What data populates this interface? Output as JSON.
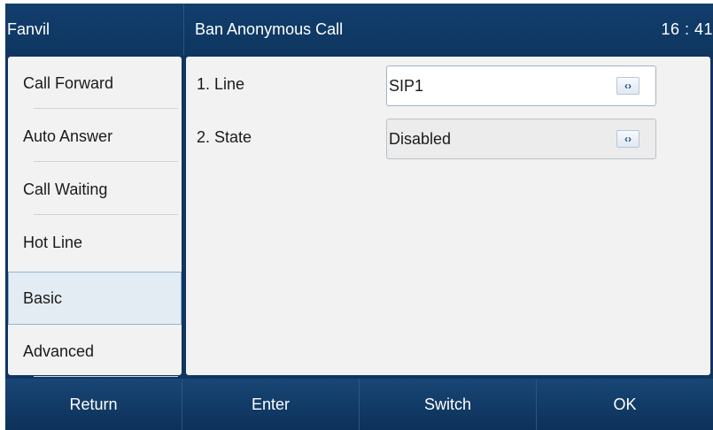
{
  "header": {
    "brand": "Fanvil",
    "title": "Ban Anonymous Call",
    "clock": "16 : 41"
  },
  "sidebar": {
    "items": [
      {
        "label": "Call Forward"
      },
      {
        "label": "Auto Answer"
      },
      {
        "label": "Call Waiting"
      },
      {
        "label": "Hot Line"
      },
      {
        "label": "Basic",
        "selected": true
      },
      {
        "label": "Advanced"
      }
    ]
  },
  "settings": [
    {
      "label": "1. Line",
      "value": "SIP1",
      "control_icon": "left-right-arrows-icon",
      "arrow_glyph": "‹›"
    },
    {
      "label": "2. State",
      "value": "Disabled",
      "control_icon": "left-right-arrows-icon",
      "arrow_glyph": "‹›"
    }
  ],
  "softkeys": [
    {
      "label": "Return"
    },
    {
      "label": "Enter"
    },
    {
      "label": "Switch"
    },
    {
      "label": "OK"
    }
  ],
  "colors": {
    "header_bg": "#0f3560",
    "panel_bg": "#f2f2f2",
    "selected_bg": "#e4ecf3",
    "accent": "#1d4f85"
  }
}
